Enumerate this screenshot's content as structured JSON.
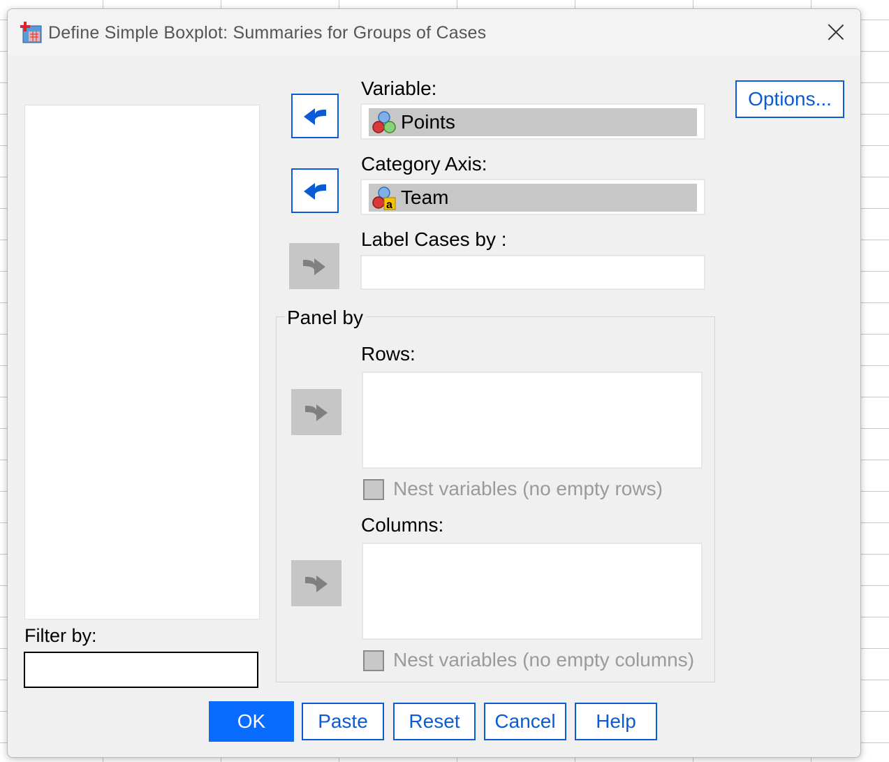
{
  "window": {
    "title": "Define Simple Boxplot: Summaries for Groups of Cases",
    "close_icon": "close-icon"
  },
  "variable_list": {
    "items": []
  },
  "filter": {
    "label": "Filter by:",
    "value": ""
  },
  "variable": {
    "label": "Variable:",
    "value": "Points",
    "icon": "scale-variable-icon"
  },
  "category_axis": {
    "label": "Category Axis:",
    "value": "Team",
    "icon": "nominal-string-variable-icon"
  },
  "label_cases": {
    "label": "Label Cases by :",
    "value": ""
  },
  "panel_by": {
    "title": "Panel by",
    "rows_label": "Rows:",
    "nest_rows_label": "Nest variables (no empty rows)",
    "nest_rows_checked": false,
    "columns_label": "Columns:",
    "nest_columns_label": "Nest variables (no empty columns)",
    "nest_columns_checked": false
  },
  "options_button": "Options...",
  "buttons": {
    "ok": "OK",
    "paste": "Paste",
    "reset": "Reset",
    "cancel": "Cancel",
    "help": "Help"
  },
  "colors": {
    "accent": "#0a5bd5",
    "primary_button": "#0a6cff",
    "disabled_gray": "#c6c6c6"
  }
}
